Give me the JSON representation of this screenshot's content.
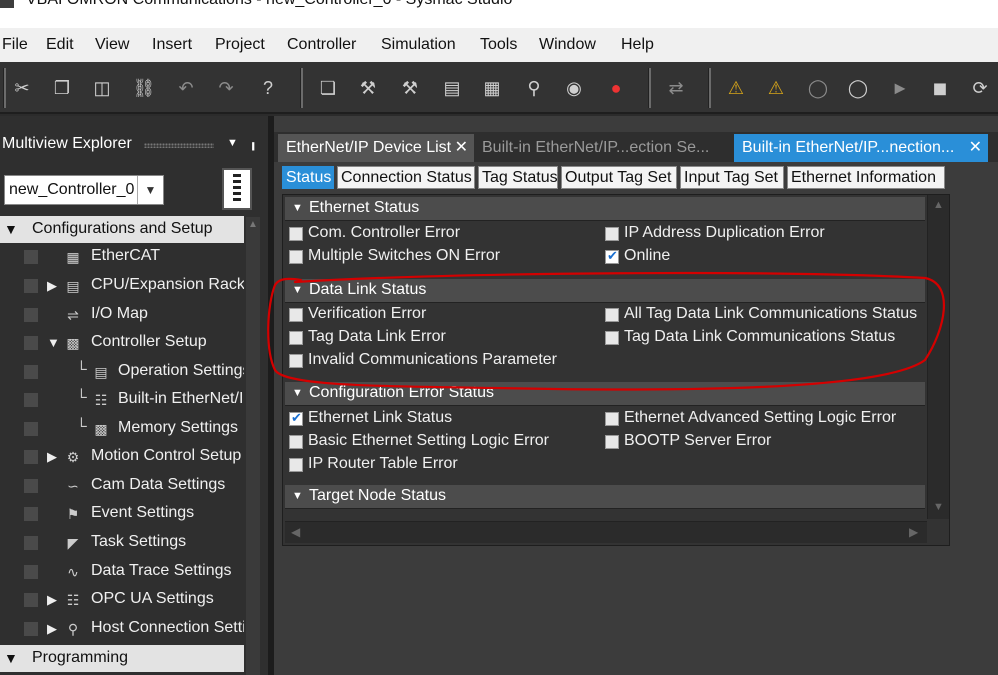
{
  "window": {
    "title": "VBAI OMRON Communications - new_Controller_0 - Sysmac Studio"
  },
  "menu": [
    "File",
    "Edit",
    "View",
    "Insert",
    "Project",
    "Controller",
    "Simulation",
    "Tools",
    "Window",
    "Help"
  ],
  "toolbar_icons": [
    "cut-icon",
    "copy-icon",
    "paste-icon",
    "delete-icon",
    "undo-icon",
    "redo-icon",
    "help-icon",
    "window-icon",
    "build-icon",
    "rebuild-icon",
    "compare-icon",
    "transfer-icon",
    "search-icon",
    "binoculars-icon",
    "error-icon",
    "sync-icon",
    "warning-icon",
    "warning-alt-icon",
    "watch-icon",
    "watch-alt-icon",
    "online-icon",
    "offline-icon",
    "reset-icon"
  ],
  "explorer": {
    "title": "Multiview Explorer",
    "controller": "new_Controller_0",
    "sections": {
      "config": "Configurations and Setup",
      "programming": "Programming"
    },
    "items": [
      "EtherCAT",
      "CPU/Expansion Racks",
      "I/O Map",
      "Controller Setup",
      "Operation Settings",
      "Built-in EtherNet/IP Port Settings",
      "Memory Settings",
      "Motion Control Setup",
      "Cam Data Settings",
      "Event Settings",
      "Task Settings",
      "Data Trace Settings",
      "OPC UA Settings",
      "Host Connection Settings"
    ]
  },
  "doc_tabs": [
    {
      "label": "EtherNet/IP Device List"
    },
    {
      "label": "Built-in EtherNet/IP...ection Se..."
    },
    {
      "label": "Built-in EtherNet/IP...nection..."
    }
  ],
  "sub_tabs": [
    "Status",
    "Connection Status",
    "Tag Status",
    "Output Tag Set",
    "Input Tag Set",
    "Ethernet Information"
  ],
  "sections": {
    "ethernet_status": {
      "title": "Ethernet Status",
      "items": [
        {
          "label": "Com. Controller Error",
          "checked": false
        },
        {
          "label": "IP Address Duplication Error",
          "checked": false
        },
        {
          "label": "Multiple Switches ON Error",
          "checked": false
        },
        {
          "label": "Online",
          "checked": true
        }
      ]
    },
    "data_link_status": {
      "title": "Data Link Status",
      "items": [
        {
          "label": "Verification Error",
          "checked": false
        },
        {
          "label": "All Tag Data Link Communications Status",
          "checked": false
        },
        {
          "label": "Tag Data Link Error",
          "checked": false
        },
        {
          "label": "Tag Data Link Communications Status",
          "checked": false
        },
        {
          "label": "Invalid Communications Parameter",
          "checked": false
        }
      ]
    },
    "config_error_status": {
      "title": "Configuration Error Status",
      "items": [
        {
          "label": "Ethernet Link Status",
          "checked": true
        },
        {
          "label": "Ethernet Advanced Setting Logic Error",
          "checked": false
        },
        {
          "label": "Basic Ethernet Setting Logic Error",
          "checked": false
        },
        {
          "label": "BOOTP Server Error",
          "checked": false
        },
        {
          "label": "IP Router Table Error",
          "checked": false
        }
      ]
    },
    "target_node_status": {
      "title": "Target Node Status"
    }
  },
  "colors": {
    "accent": "#2a8fd8",
    "annotation": "#d40000",
    "background": "#2b2b2b"
  }
}
